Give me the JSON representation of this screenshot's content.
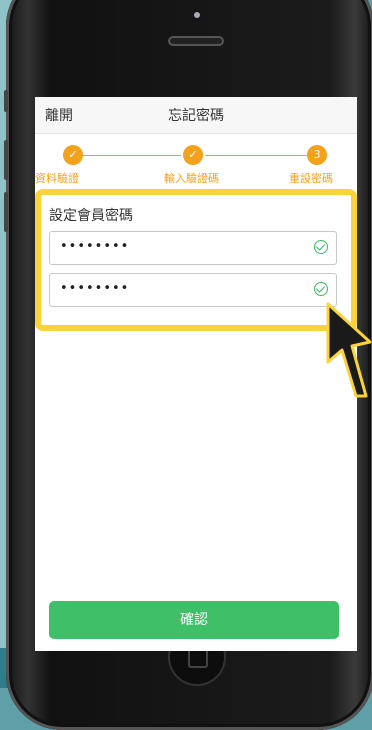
{
  "header": {
    "back_label": "離開",
    "title": "忘記密碼"
  },
  "steps": [
    {
      "label": "資料驗證",
      "state": "done"
    },
    {
      "label": "輸入驗證碼",
      "state": "done"
    },
    {
      "label": "重設密碼",
      "state": "current",
      "number": "3"
    }
  ],
  "form": {
    "section_title": "設定會員密碼",
    "password_value": "••••••••",
    "confirm_password_value": "••••••••"
  },
  "confirm_label": "確認",
  "colors": {
    "accent": "#f4a11b",
    "success": "#3fbf68",
    "highlight": "#f9d23c"
  }
}
